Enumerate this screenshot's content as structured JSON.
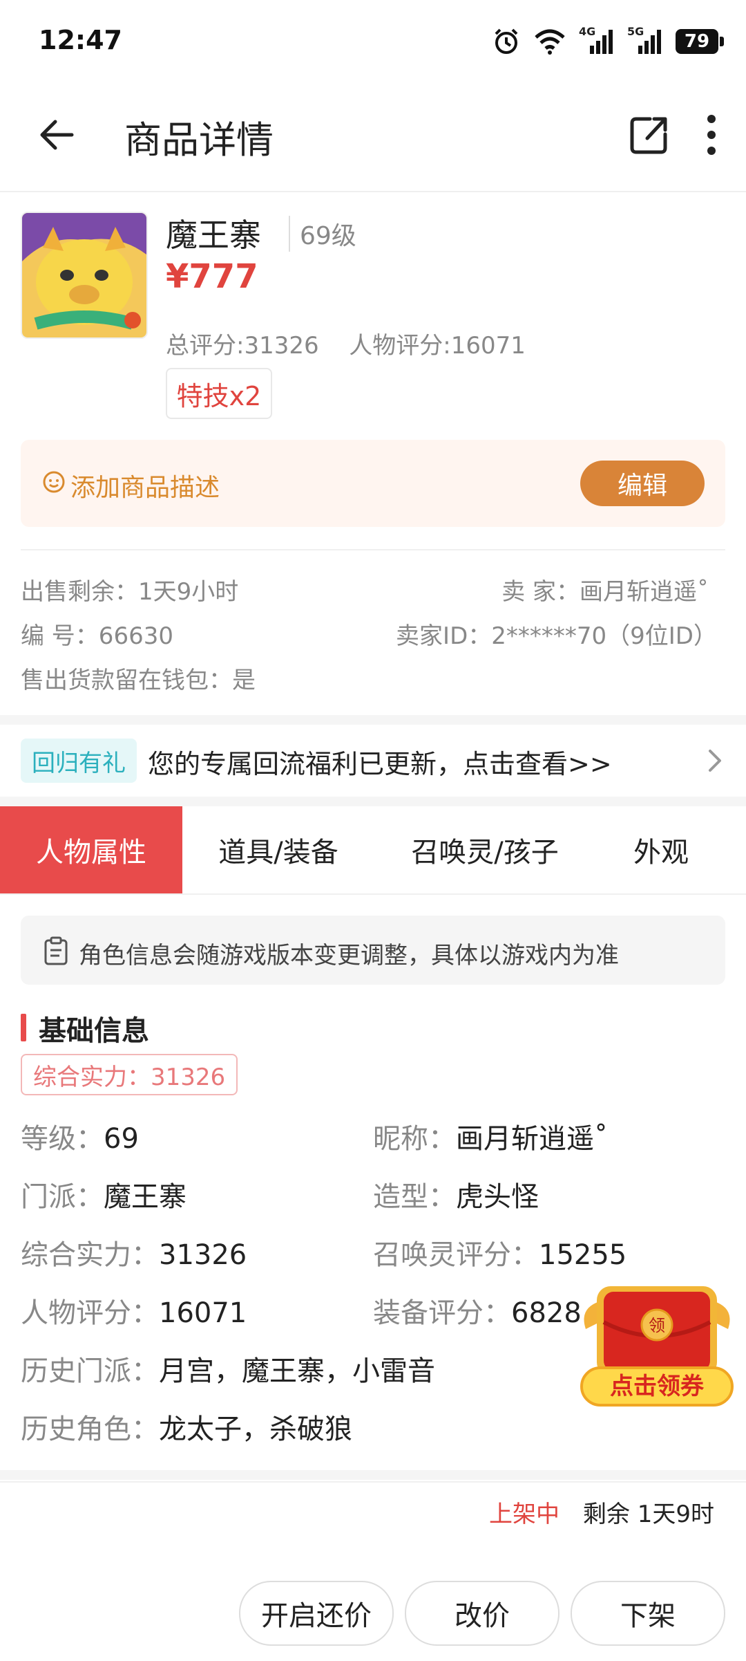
{
  "status_bar": {
    "time": "12:47",
    "battery": "79",
    "net1": "4G",
    "net2": "5G"
  },
  "app_bar": {
    "title": "商品详情"
  },
  "product": {
    "name": "魔王寨",
    "level": "69级",
    "price": "¥777",
    "total_score": "总评分:31326",
    "char_score": "人物评分:16071",
    "tag": "特技x2"
  },
  "description": {
    "placeholder": "添加商品描述",
    "edit_label": "编辑"
  },
  "sale_info": {
    "remaining": "出售剩余：1天9小时",
    "seller": "卖 家：画月斩逍遥˚",
    "number": "编 号：66630",
    "seller_id": "卖家ID：2******70（9位ID）",
    "wallet": "售出货款留在钱包：是"
  },
  "promo": {
    "tag": "回归有礼",
    "text": "您的专属回流福利已更新，点击查看>>"
  },
  "tabs": [
    {
      "label": "人物属性",
      "active": true
    },
    {
      "label": "道具/装备",
      "active": false
    },
    {
      "label": "召唤灵/孩子",
      "active": false
    },
    {
      "label": "外观",
      "active": false
    }
  ],
  "notice": "角色信息会随游戏版本变更调整，具体以游戏内为准",
  "basic_info": {
    "title": "基础信息",
    "power_badge": "综合实力：31326",
    "fields": [
      {
        "k": "等级：",
        "v": "69"
      },
      {
        "k": "昵称：",
        "v": "画月斩逍遥˚"
      },
      {
        "k": "门派：",
        "v": "魔王寨"
      },
      {
        "k": "造型：",
        "v": "虎头怪"
      },
      {
        "k": "综合实力：",
        "v": "31326"
      },
      {
        "k": "召唤灵评分：",
        "v": "15255"
      },
      {
        "k": "人物评分：",
        "v": "16071"
      },
      {
        "k": "装备评分：",
        "v": "6828"
      },
      {
        "k": "历史门派：",
        "v": "月宫，魔王寨，小雷音"
      },
      {
        "k": "历史角色：",
        "v": "龙太子，杀破狼"
      }
    ]
  },
  "coupon": {
    "badge": "领",
    "label": "点击领券"
  },
  "bottom": {
    "status": "上架中",
    "remaining": "剩余 1天9时",
    "buttons": [
      "开启还价",
      "改价",
      "下架"
    ]
  },
  "colors": {
    "accent": "#e84b4b",
    "price": "#e0443e",
    "edit": "#d98438",
    "promo": "#2bb0bd"
  }
}
